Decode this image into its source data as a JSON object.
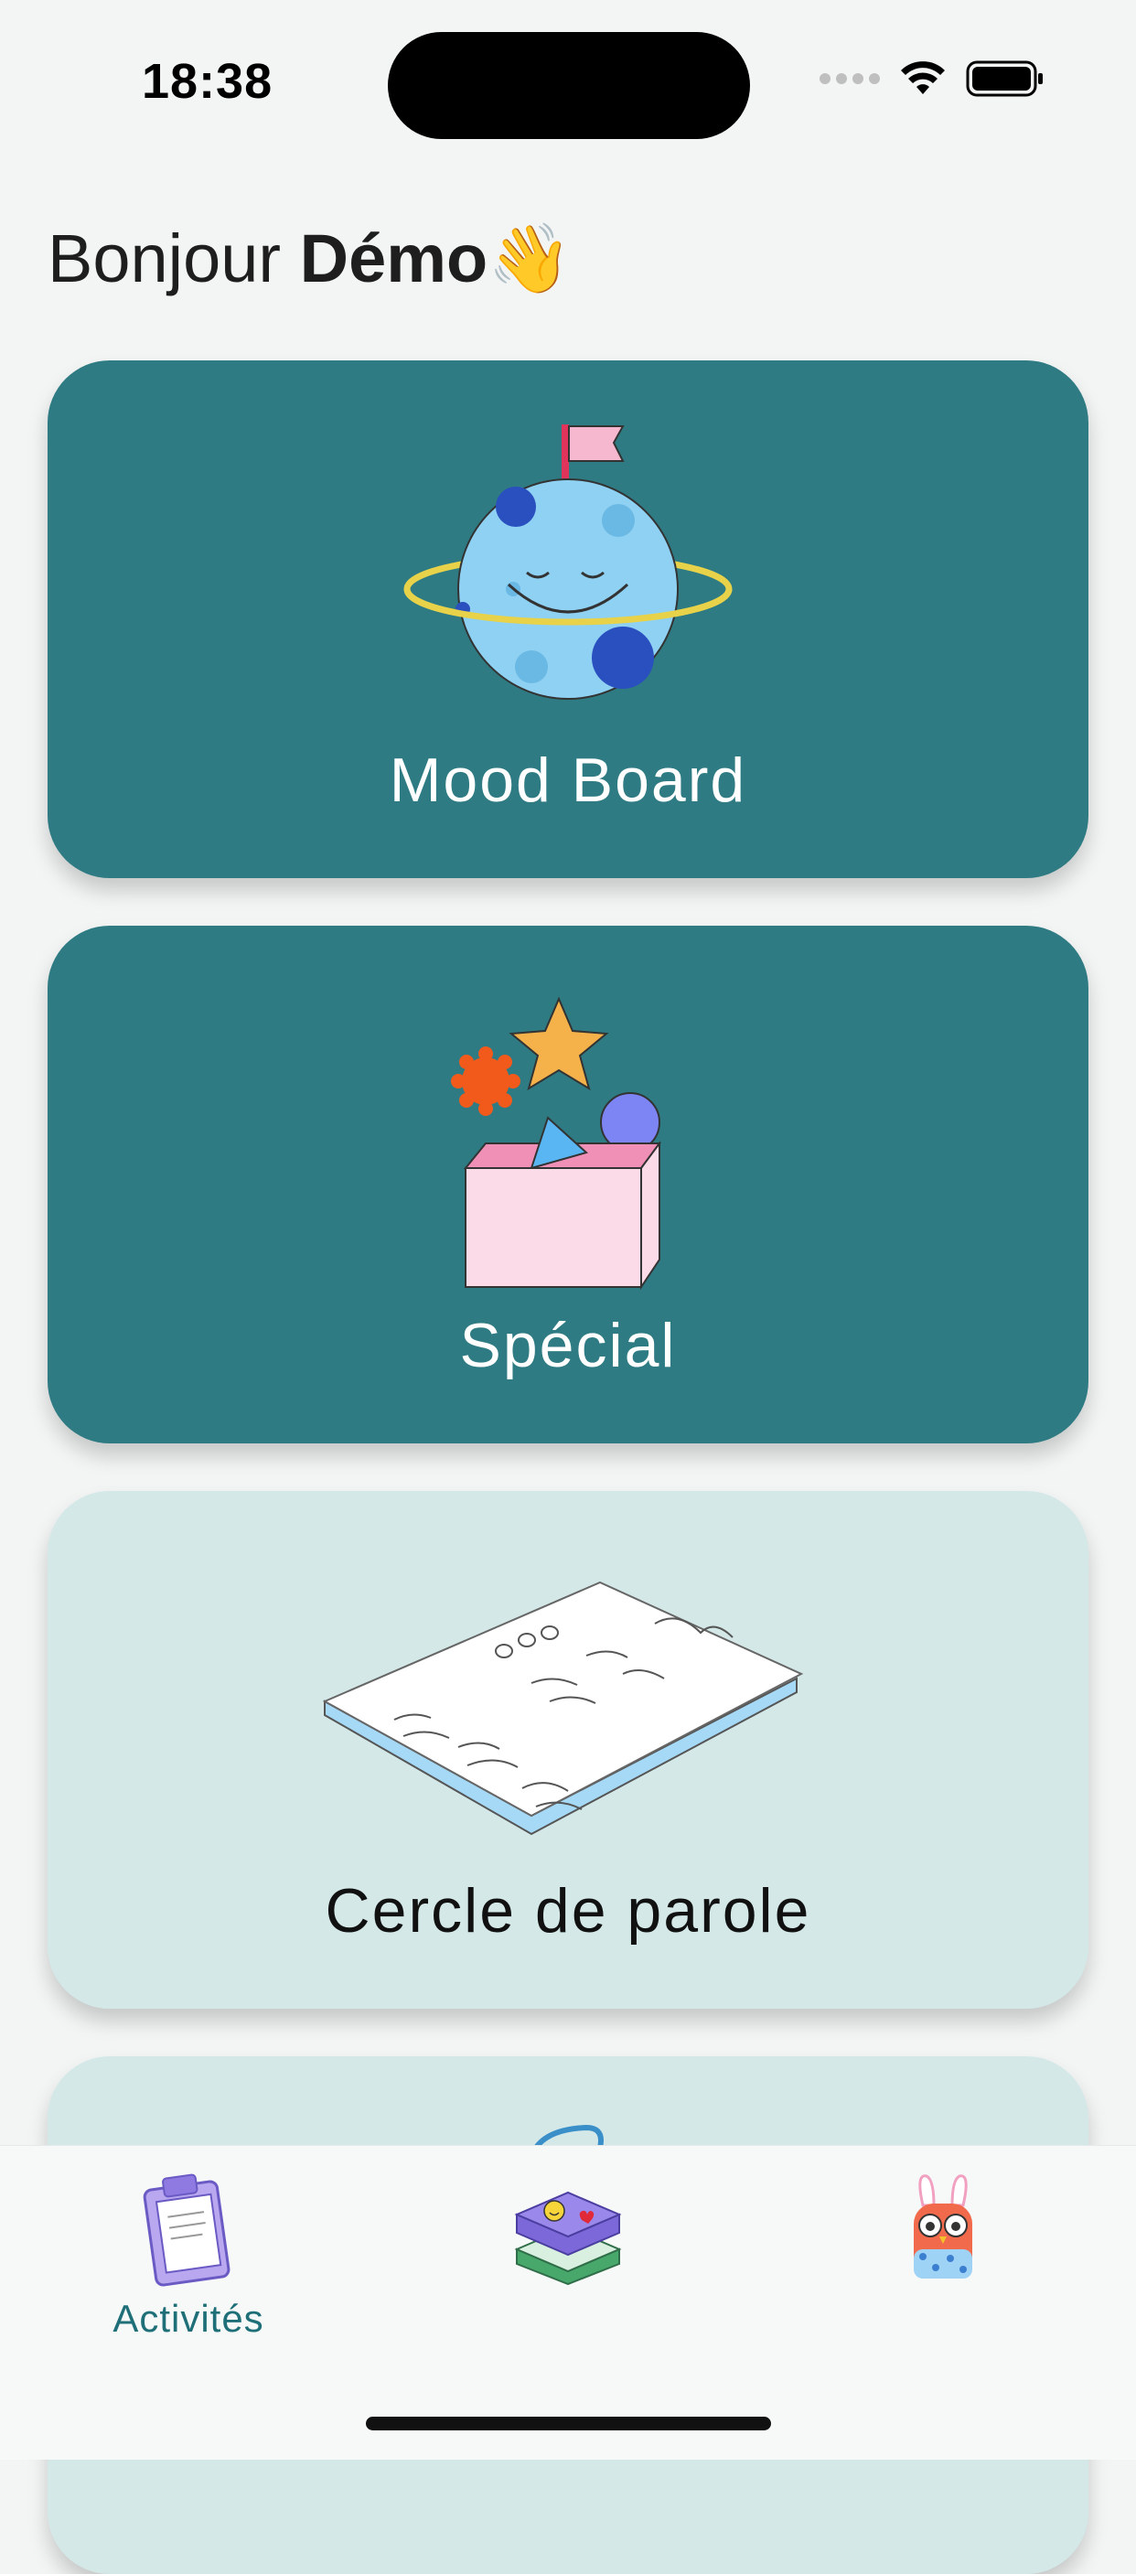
{
  "status_bar": {
    "time": "18:38"
  },
  "greeting": {
    "prefix": "Bonjour ",
    "name": "Démo",
    "emoji": "👋"
  },
  "cards": [
    {
      "label": "Mood Board",
      "icon": "planet-icon",
      "style": "dark"
    },
    {
      "label": "Spécial",
      "icon": "toy-box-icon",
      "style": "dark"
    },
    {
      "label": "Cercle de parole",
      "icon": "notebook-icon",
      "style": "light"
    },
    {
      "label": "",
      "icon": "partial-card-icon",
      "style": "light"
    }
  ],
  "tab_bar": {
    "tabs": [
      {
        "label": "Activités",
        "icon": "clipboard-icon",
        "active": true
      },
      {
        "label": "",
        "icon": "books-icon",
        "active": false
      },
      {
        "label": "",
        "icon": "bunny-owl-icon",
        "active": false
      }
    ]
  },
  "colors": {
    "card_dark": "#2f7b83",
    "card_light": "#d4e8e8",
    "active_tab": "#1f6f78",
    "background": "#f3f5f5"
  }
}
